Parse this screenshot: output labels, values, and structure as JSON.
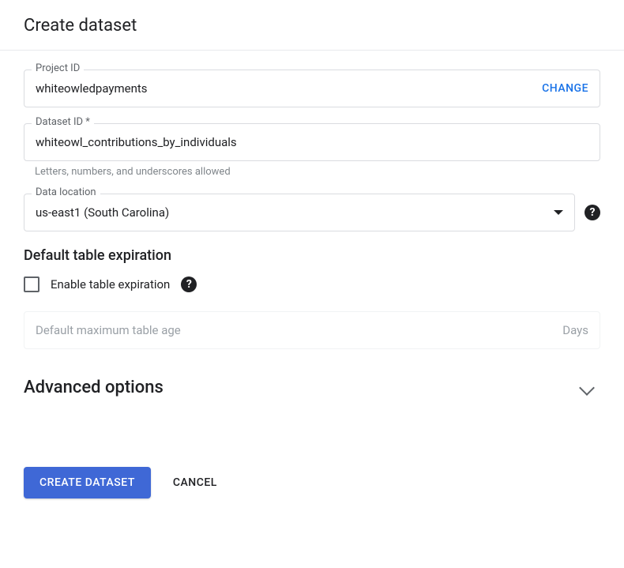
{
  "header": {
    "title": "Create dataset"
  },
  "project": {
    "label": "Project ID",
    "value": "whiteowledpayments",
    "change_label": "CHANGE"
  },
  "dataset": {
    "label": "Dataset ID *",
    "value": "whiteowl_contributions_by_individuals",
    "helper": "Letters, numbers, and underscores allowed"
  },
  "location": {
    "label": "Data location",
    "value": "us-east1 (South Carolina)"
  },
  "expiration": {
    "section_title": "Default table expiration",
    "checkbox_label": "Enable table expiration",
    "max_age_placeholder": "Default maximum table age",
    "unit": "Days"
  },
  "advanced": {
    "title": "Advanced options"
  },
  "footer": {
    "create_label": "CREATE DATASET",
    "cancel_label": "CANCEL"
  }
}
